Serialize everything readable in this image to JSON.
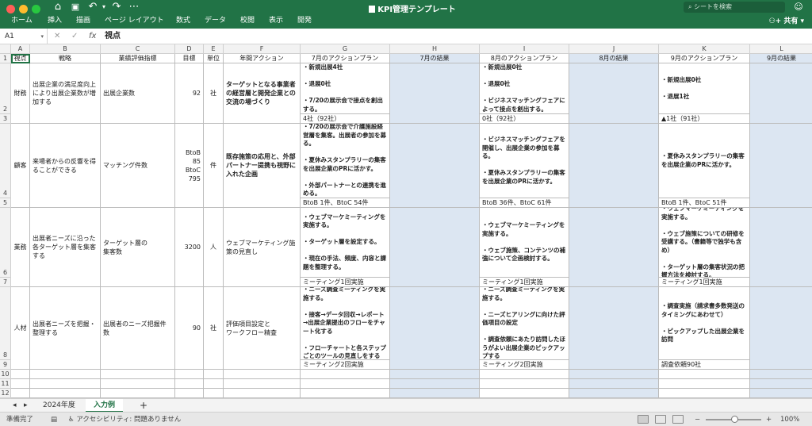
{
  "window": {
    "title": "KPI管理テンプレート"
  },
  "ribbon": {
    "tabs": [
      "ホーム",
      "挿入",
      "描画",
      "ページ レイアウト",
      "数式",
      "データ",
      "校閲",
      "表示",
      "開発"
    ],
    "search_placeholder": "シートを検索",
    "share_label": "共有"
  },
  "formula_bar": {
    "name_box": "A1",
    "fx": "fx",
    "value": "視点"
  },
  "columns": [
    "A",
    "B",
    "C",
    "D",
    "E",
    "F",
    "G",
    "H",
    "I",
    "J",
    "K",
    "L"
  ],
  "rows": [
    "1",
    "2",
    "3",
    "4",
    "5",
    "6",
    "7",
    "8",
    "9",
    "10",
    "11",
    "12"
  ],
  "headers": [
    "視点",
    "戦略",
    "業績評価指標",
    "目標",
    "単位",
    "年間アクション",
    "7月のアクションプラン",
    "7月の結果",
    "8月のアクションプラン",
    "8月の結果",
    "9月のアクションプラン",
    "9月の結果"
  ],
  "records": [
    {
      "perspective": "財務",
      "strategy": "出展企業の満足度向上により出展企業数が増加する",
      "kpi": "出展企業数",
      "target": "92",
      "unit": "社",
      "annual_action": "ターゲットとなる事業者の経営層と開発企業との交流の場づくり",
      "plan7": "・新規出展4社\n\n・退展0社\n\n・7/20の展示会で接点を創出する。",
      "plan8": "・新規出展0社\n\n・退展0社\n\n・ビジネスマッチングフェアによって接点を創出する。",
      "plan9": "・新規出展0社\n\n・退展1社",
      "res7": "4社（92社）",
      "res8": "0社（92社）",
      "res9": "▲1社（91社）"
    },
    {
      "perspective": "顧客",
      "strategy": "来場者からの反響を得ることができる",
      "kpi": "マッチング件数",
      "target": "BtoB 85\nBtoC 795",
      "unit": "件",
      "annual_action": "既存施策の応用と、外部パートナー提携も視野に入れた企画",
      "plan7": "・7/20の展示会で介護施設経営層を集客。出展者の参加を募る。\n\n・夏休みスタンプラリーの集客を出展企業のPRに活かす。\n\n・外部パートナーとの連携を進める。",
      "plan8": "・ビジネスマッチングフェアを開催し、出展企業の参加を募る。\n\n・夏休みスタンプラリーの集客を出展企業のPRに活かす。",
      "plan9": "・夏休みスタンプラリーの集客を出展企業のPRに活かす。",
      "res7": "BtoB 1件、BtoC 54件",
      "res8": "BtoB 36件、BtoC 61件",
      "res9": "BtoB 1件、BtoC 51件"
    },
    {
      "perspective": "業務",
      "strategy": "出展者ニーズに沿った各ターゲット層を集客する",
      "kpi": "ターゲット層の\n集客数",
      "target": "3200",
      "unit": "人",
      "annual_action": "ウェブマーケティング施策の見直し",
      "plan7": "・ウェブマーケミーティングを実施する。\n\n・ターゲット層を設定する。\n\n・現在の手法、頻度、内容と課題を整理する。",
      "plan8": "・ウェブマーケミーティングを実施する。\n\n・ウェブ施策、コンテンツの補強について企画検討する。",
      "plan9": "・ウェブマーケミーティングを実施する。\n\n・ウェブ施策についての研修を受講する。（書籍等で独学も含め）\n\n・ターゲット層の集客状況の把握方法を検討する。",
      "res7": "ミーティング1回実施",
      "res8": "ミーティング1回実施",
      "res9": "ミーティング1回実施"
    },
    {
      "perspective": "人材",
      "strategy": "出展者ニーズを把握・整理する",
      "kpi": "出展者のニーズ把握件数",
      "target": "90",
      "unit": "社",
      "annual_action": "評価項目設定と\nワークフロー精査",
      "plan7": "・ニーズ調査ミーティングを実施する。\n\n・接客→データ回収→レポート→出展企業提出のフローをチャート化する\n\n・フローチャートと各ステップごとのツールの見直しをする",
      "plan8": "・ニーズ調査ミーティングを実施する。\n\n・ニーズヒアリングに向けた評価項目の設定\n\n・調査依頼にあたり訪問したほうがよい出展企業のピックアップする",
      "plan9": "・調査実施（請求書多数発送のタイミングにあわせて）\n\n・ピックアップした出展企業を訪問",
      "res7": "ミーティング2回実施",
      "res8": "ミーティング2回実施",
      "res9": "調査依頼90社"
    }
  ],
  "sheet_tabs": [
    "2024年度",
    "入力例"
  ],
  "active_sheet": "入力例",
  "add_sheet": "+",
  "status": {
    "ready": "準備完了",
    "accessibility": "アクセシビリティ: 問題ありません",
    "zoom": "100%"
  },
  "colors": {
    "accent": "#217346",
    "result_fill": "#dce6f2"
  }
}
